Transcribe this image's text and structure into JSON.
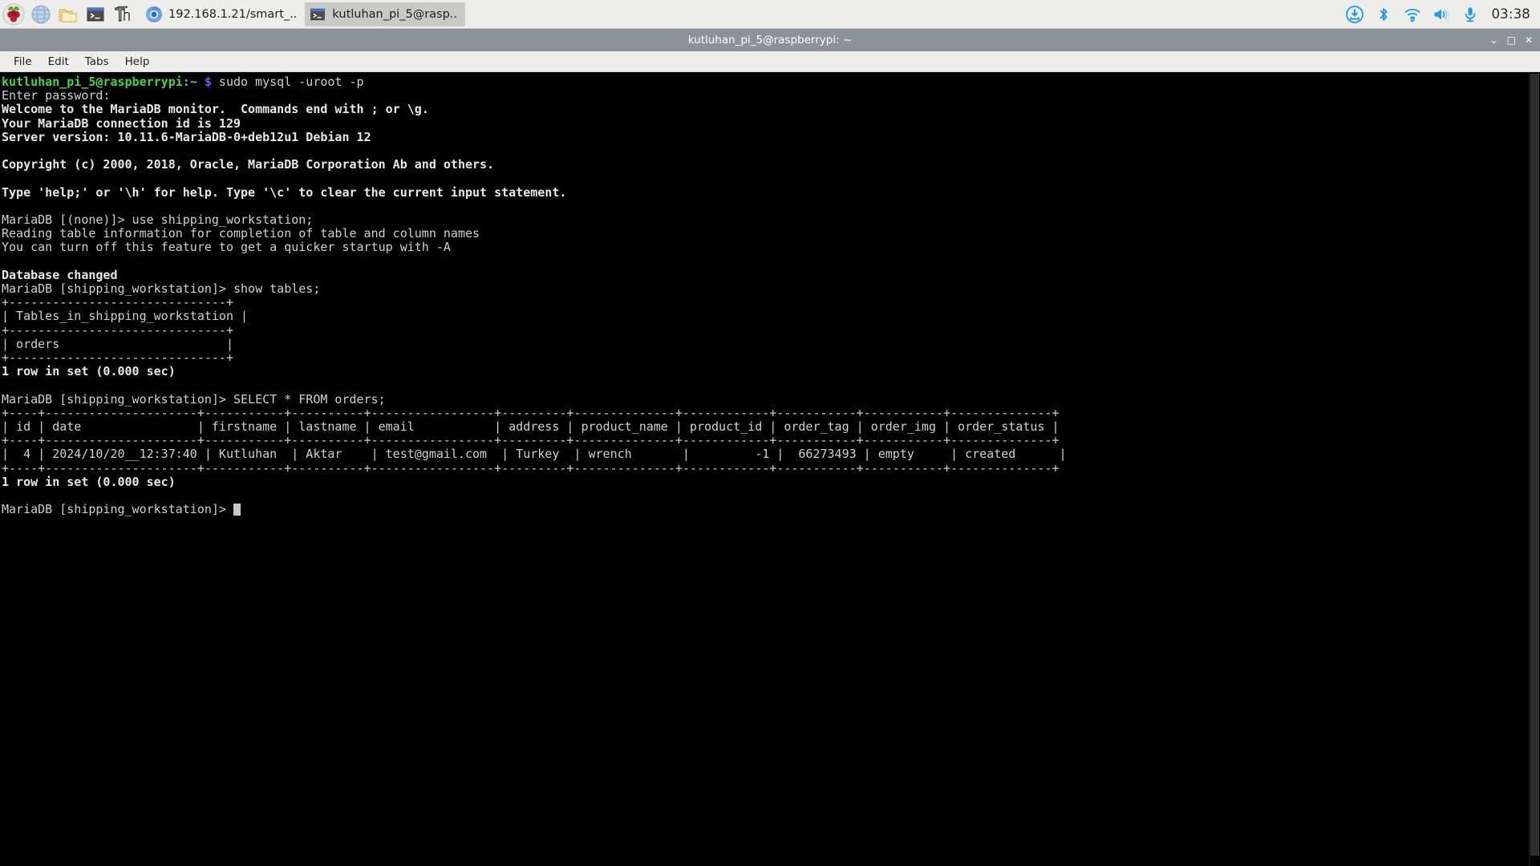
{
  "taskbar": {
    "launchers": [
      {
        "name": "raspberry-menu-icon",
        "label": "Raspberry Pi Menu"
      },
      {
        "name": "web-browser-icon",
        "label": "Web Browser"
      },
      {
        "name": "file-manager-icon",
        "label": "File Manager"
      },
      {
        "name": "terminal-icon",
        "label": "Terminal"
      },
      {
        "name": "thonny-icon",
        "label": "Thonny Python IDE"
      }
    ],
    "windows": [
      {
        "name": "chromium-window-button",
        "icon": "chromium-icon",
        "label": "192.168.1.21/smart_..",
        "active": false
      },
      {
        "name": "terminal-window-button",
        "icon": "terminal-icon",
        "label": "kutluhan_pi_5@rasp..",
        "active": true
      }
    ],
    "tray": [
      {
        "name": "software-update-icon",
        "label": "Updates Available"
      },
      {
        "name": "bluetooth-icon",
        "label": "Bluetooth"
      },
      {
        "name": "wifi-icon",
        "label": "Wireless Network"
      },
      {
        "name": "volume-icon",
        "label": "Volume"
      },
      {
        "name": "microphone-icon",
        "label": "Microphone"
      }
    ],
    "clock": "03:38",
    "accent_color": "#1e9bf0",
    "background_color": "#ededeb"
  },
  "window": {
    "title": "kutluhan_pi_5@raspberrypi: ~",
    "titlebar_color": "#8c9299",
    "controls": [
      {
        "name": "minimize-button",
        "glyph": "⌄"
      },
      {
        "name": "maximize-button",
        "glyph": "□"
      },
      {
        "name": "close-button",
        "glyph": "✕"
      }
    ],
    "menu": [
      {
        "name": "menu-file",
        "label": "File"
      },
      {
        "name": "menu-edit",
        "label": "Edit"
      },
      {
        "name": "menu-tabs",
        "label": "Tabs"
      },
      {
        "name": "menu-help",
        "label": "Help"
      }
    ]
  },
  "terminal": {
    "background_color": "#000000",
    "foreground_color": "#d0d0d0",
    "prompt_user_color": "#44d544",
    "prompt_path_color": "#34c8d8",
    "shell_prompt_user": "kutluhan_pi_5@raspberrypi",
    "shell_prompt_path": ":~",
    "shell_prompt_symbol": "$",
    "shell_command": "sudo mysql -uroot -p",
    "password_prompt": "Enter password:",
    "banner": [
      "Welcome to the MariaDB monitor.  Commands end with ; or \\g.",
      "Your MariaDB connection id is 129",
      "Server version: 10.11.6-MariaDB-0+deb12u1 Debian 12",
      "",
      "Copyright (c) 2000, 2018, Oracle, MariaDB Corporation Ab and others.",
      "",
      "Type 'help;' or '\\h' for help. Type '\\c' to clear the current input statement."
    ],
    "mysql_prompt_none": "MariaDB [(none)]>",
    "mysql_prompt_db": "MariaDB [shipping_workstation]>",
    "command_use": " use shipping_workstation;",
    "use_output": [
      "Reading table information for completion of table and column names",
      "You can turn off this feature to get a quicker startup with -A",
      "",
      "Database changed"
    ],
    "command_show_tables": " show tables;",
    "tables_result": {
      "divider": "+------------------------------+",
      "header": "| Tables_in_shipping_workstation |",
      "header_line": "| Tables_in_shipping_workstation |",
      "rows": [
        "| orders                       |"
      ],
      "footer": "1 row in set (0.000 sec)"
    },
    "command_select": " SELECT * FROM orders;",
    "orders_result": {
      "divider": "+----+---------------------+-----------+----------+-----------------+---------+--------------+------------+-----------+-----------+--------------+",
      "header": "| id | date                | firstname | lastname | email           | address | product_name | product_id | order_tag | order_img | order_status |",
      "row": "|  4 | 2024/10/20__12:37:40 | Kutluhan  | Aktar    | test@gmail.com  | Turkey  | wrench       |         -1 |  66273493 | empty     | created      |",
      "footer": "1 row in set (0.000 sec)"
    },
    "cursor_visible": true
  },
  "db": {
    "columns": [
      "id",
      "date",
      "firstname",
      "lastname",
      "email",
      "address",
      "product_name",
      "product_id",
      "order_tag",
      "order_img",
      "order_status"
    ],
    "rows": [
      {
        "id": "4",
        "date": "2024/10/20__12:37:40",
        "firstname": "Kutluhan",
        "lastname": "Aktar",
        "email": "test@gmail.com",
        "address": "Turkey",
        "product_name": "wrench",
        "product_id": "-1",
        "order_tag": "66273493",
        "order_img": "empty",
        "order_status": "created"
      }
    ],
    "database": "shipping_workstation",
    "table": "orders",
    "row_count": "1 row in set (0.000 sec)"
  }
}
